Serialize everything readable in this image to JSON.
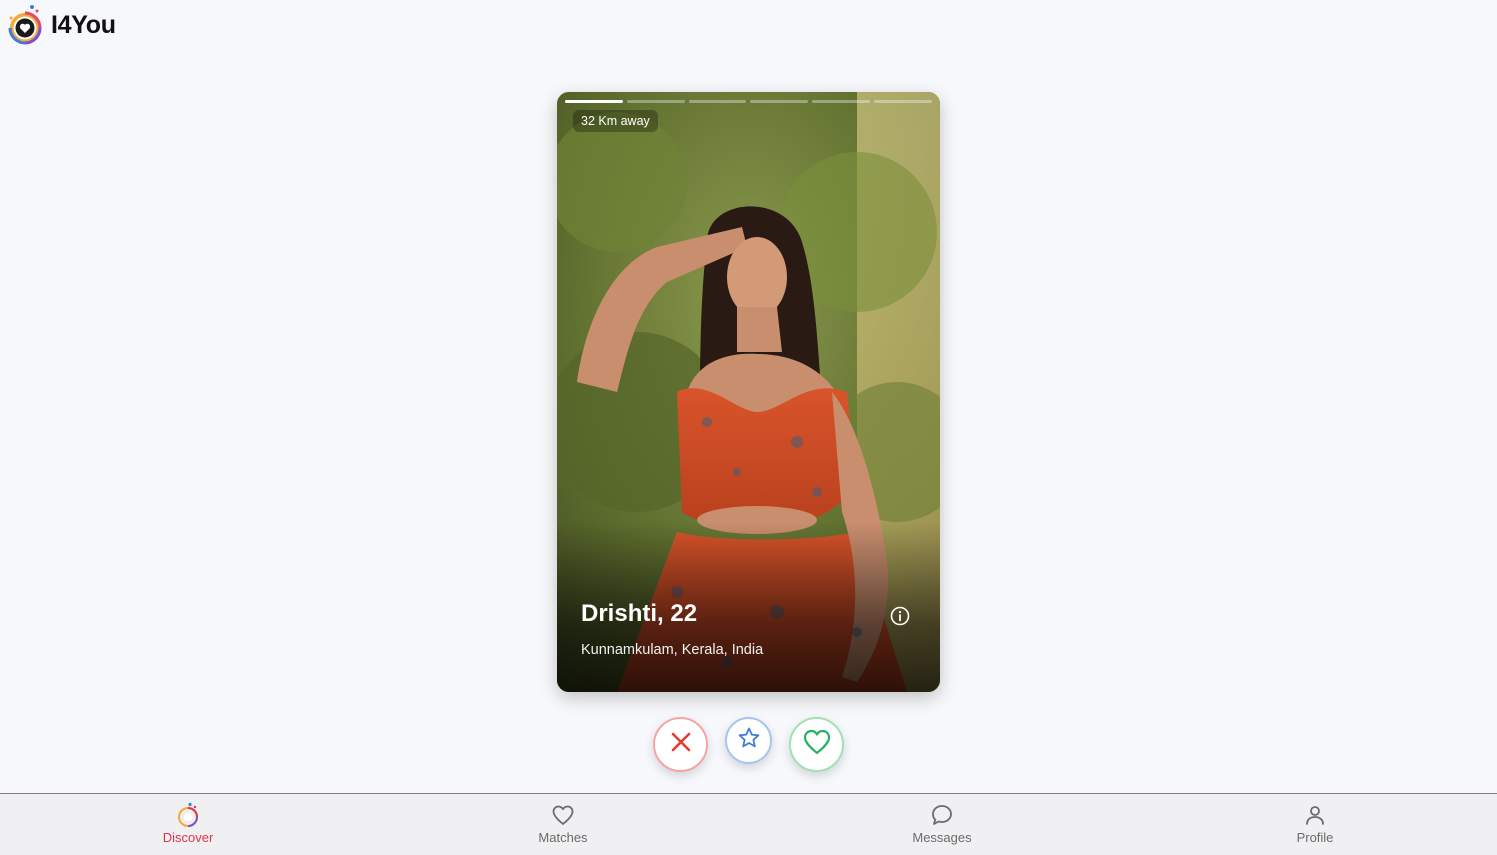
{
  "app": {
    "name": "I4You"
  },
  "card": {
    "distance": "32 Km away",
    "name_age": "Drishti, 22",
    "location": "Kunnamkulam, Kerala, India",
    "photo_count": 6,
    "active_photo_index": 0
  },
  "actions": {
    "nope_icon": "close-icon",
    "superlike_icon": "star-icon",
    "like_icon": "heart-icon"
  },
  "nav": {
    "items": [
      {
        "label": "Discover",
        "icon": "discover-icon",
        "active": true
      },
      {
        "label": "Matches",
        "icon": "heart-outline-icon",
        "active": false
      },
      {
        "label": "Messages",
        "icon": "chat-bubble-icon",
        "active": false
      },
      {
        "label": "Profile",
        "icon": "user-icon",
        "active": false
      }
    ]
  },
  "colors": {
    "accent": "#e0344a",
    "nope": "#e53935",
    "superlike": "#3b7ddd",
    "like": "#22b35b",
    "background": "#f7f8fb"
  }
}
